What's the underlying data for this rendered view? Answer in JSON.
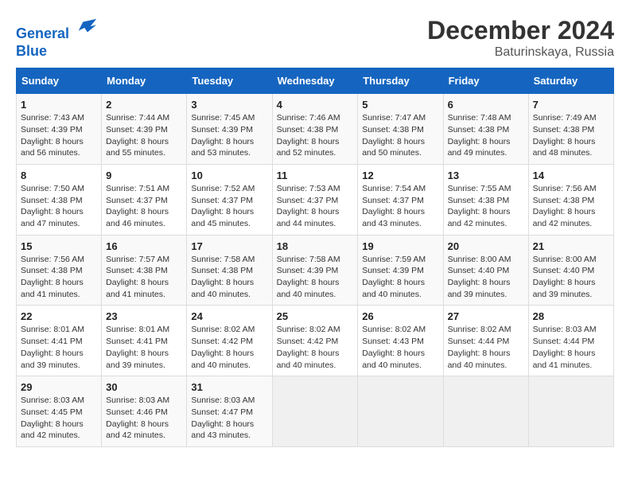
{
  "header": {
    "logo_line1": "General",
    "logo_line2": "Blue",
    "month_title": "December 2024",
    "location": "Baturinskaya, Russia"
  },
  "weekdays": [
    "Sunday",
    "Monday",
    "Tuesday",
    "Wednesday",
    "Thursday",
    "Friday",
    "Saturday"
  ],
  "weeks": [
    [
      {
        "day": "1",
        "sunrise": "7:43 AM",
        "sunset": "4:39 PM",
        "daylight": "8 hours and 56 minutes."
      },
      {
        "day": "2",
        "sunrise": "7:44 AM",
        "sunset": "4:39 PM",
        "daylight": "8 hours and 55 minutes."
      },
      {
        "day": "3",
        "sunrise": "7:45 AM",
        "sunset": "4:39 PM",
        "daylight": "8 hours and 53 minutes."
      },
      {
        "day": "4",
        "sunrise": "7:46 AM",
        "sunset": "4:38 PM",
        "daylight": "8 hours and 52 minutes."
      },
      {
        "day": "5",
        "sunrise": "7:47 AM",
        "sunset": "4:38 PM",
        "daylight": "8 hours and 50 minutes."
      },
      {
        "day": "6",
        "sunrise": "7:48 AM",
        "sunset": "4:38 PM",
        "daylight": "8 hours and 49 minutes."
      },
      {
        "day": "7",
        "sunrise": "7:49 AM",
        "sunset": "4:38 PM",
        "daylight": "8 hours and 48 minutes."
      }
    ],
    [
      {
        "day": "8",
        "sunrise": "7:50 AM",
        "sunset": "4:38 PM",
        "daylight": "8 hours and 47 minutes."
      },
      {
        "day": "9",
        "sunrise": "7:51 AM",
        "sunset": "4:37 PM",
        "daylight": "8 hours and 46 minutes."
      },
      {
        "day": "10",
        "sunrise": "7:52 AM",
        "sunset": "4:37 PM",
        "daylight": "8 hours and 45 minutes."
      },
      {
        "day": "11",
        "sunrise": "7:53 AM",
        "sunset": "4:37 PM",
        "daylight": "8 hours and 44 minutes."
      },
      {
        "day": "12",
        "sunrise": "7:54 AM",
        "sunset": "4:37 PM",
        "daylight": "8 hours and 43 minutes."
      },
      {
        "day": "13",
        "sunrise": "7:55 AM",
        "sunset": "4:38 PM",
        "daylight": "8 hours and 42 minutes."
      },
      {
        "day": "14",
        "sunrise": "7:56 AM",
        "sunset": "4:38 PM",
        "daylight": "8 hours and 42 minutes."
      }
    ],
    [
      {
        "day": "15",
        "sunrise": "7:56 AM",
        "sunset": "4:38 PM",
        "daylight": "8 hours and 41 minutes."
      },
      {
        "day": "16",
        "sunrise": "7:57 AM",
        "sunset": "4:38 PM",
        "daylight": "8 hours and 41 minutes."
      },
      {
        "day": "17",
        "sunrise": "7:58 AM",
        "sunset": "4:38 PM",
        "daylight": "8 hours and 40 minutes."
      },
      {
        "day": "18",
        "sunrise": "7:58 AM",
        "sunset": "4:39 PM",
        "daylight": "8 hours and 40 minutes."
      },
      {
        "day": "19",
        "sunrise": "7:59 AM",
        "sunset": "4:39 PM",
        "daylight": "8 hours and 40 minutes."
      },
      {
        "day": "20",
        "sunrise": "8:00 AM",
        "sunset": "4:40 PM",
        "daylight": "8 hours and 39 minutes."
      },
      {
        "day": "21",
        "sunrise": "8:00 AM",
        "sunset": "4:40 PM",
        "daylight": "8 hours and 39 minutes."
      }
    ],
    [
      {
        "day": "22",
        "sunrise": "8:01 AM",
        "sunset": "4:41 PM",
        "daylight": "8 hours and 39 minutes."
      },
      {
        "day": "23",
        "sunrise": "8:01 AM",
        "sunset": "4:41 PM",
        "daylight": "8 hours and 39 minutes."
      },
      {
        "day": "24",
        "sunrise": "8:02 AM",
        "sunset": "4:42 PM",
        "daylight": "8 hours and 40 minutes."
      },
      {
        "day": "25",
        "sunrise": "8:02 AM",
        "sunset": "4:42 PM",
        "daylight": "8 hours and 40 minutes."
      },
      {
        "day": "26",
        "sunrise": "8:02 AM",
        "sunset": "4:43 PM",
        "daylight": "8 hours and 40 minutes."
      },
      {
        "day": "27",
        "sunrise": "8:02 AM",
        "sunset": "4:44 PM",
        "daylight": "8 hours and 40 minutes."
      },
      {
        "day": "28",
        "sunrise": "8:03 AM",
        "sunset": "4:44 PM",
        "daylight": "8 hours and 41 minutes."
      }
    ],
    [
      {
        "day": "29",
        "sunrise": "8:03 AM",
        "sunset": "4:45 PM",
        "daylight": "8 hours and 42 minutes."
      },
      {
        "day": "30",
        "sunrise": "8:03 AM",
        "sunset": "4:46 PM",
        "daylight": "8 hours and 42 minutes."
      },
      {
        "day": "31",
        "sunrise": "8:03 AM",
        "sunset": "4:47 PM",
        "daylight": "8 hours and 43 minutes."
      },
      null,
      null,
      null,
      null
    ]
  ]
}
